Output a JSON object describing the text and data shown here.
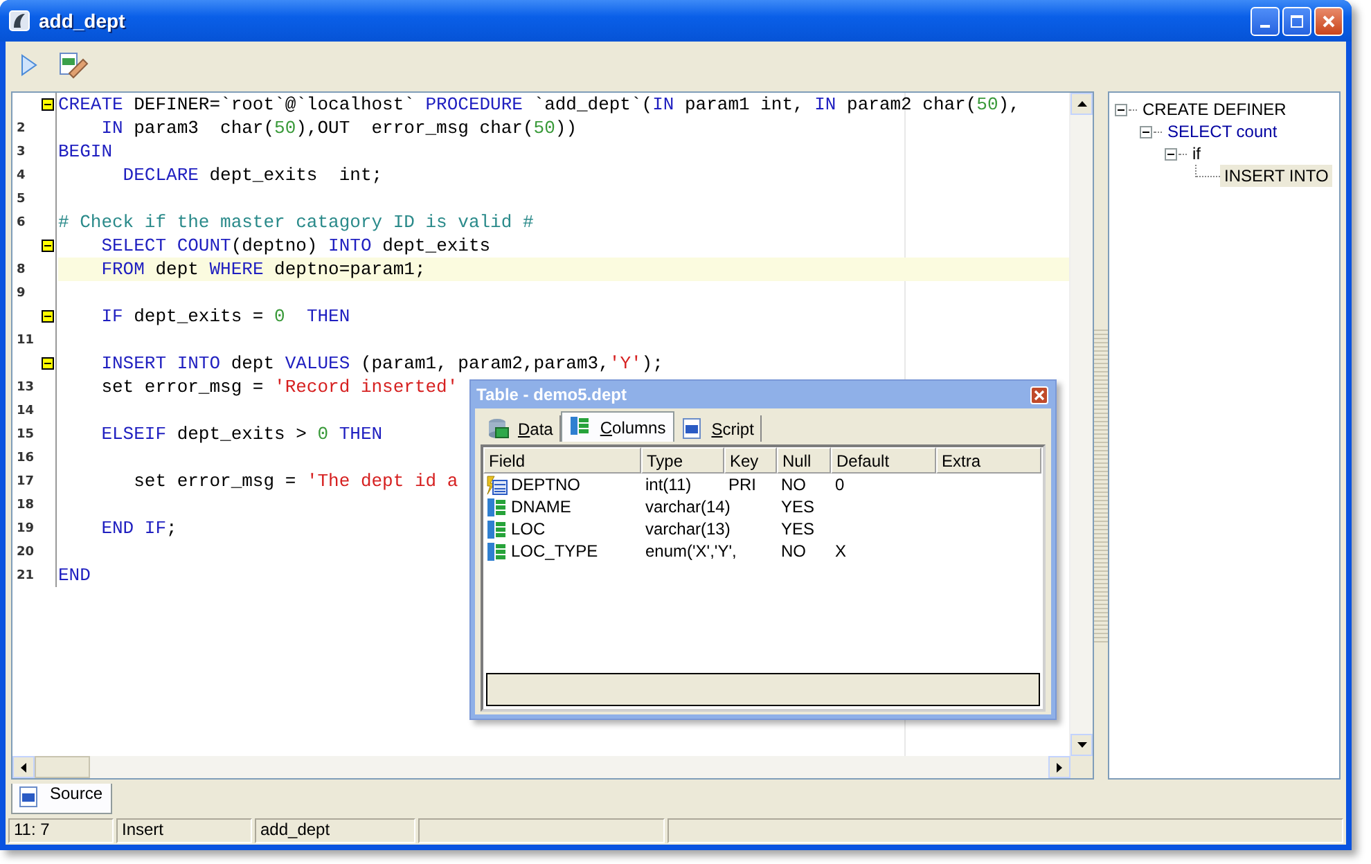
{
  "window": {
    "title": "add_dept"
  },
  "editor": {
    "lines": [
      {
        "fold": true,
        "current": false,
        "tokens": [
          {
            "text": "CREATE",
            "kind": "kw"
          },
          {
            "text": " DEFINER=`root`@`localhost` ",
            "kind": "plain"
          },
          {
            "text": "PROCEDURE",
            "kind": "kw"
          },
          {
            "text": " `add_dept`(",
            "kind": "plain"
          },
          {
            "text": "IN",
            "kind": "kw"
          },
          {
            "text": " param1 int, ",
            "kind": "plain"
          },
          {
            "text": "IN",
            "kind": "kw"
          },
          {
            "text": " param2 char(",
            "kind": "plain"
          },
          {
            "text": "50",
            "kind": "num"
          },
          {
            "text": "),",
            "kind": "plain"
          }
        ]
      },
      {
        "number": "2",
        "fold": false,
        "current": false,
        "tokens": [
          {
            "text": "    IN",
            "kind": "kw"
          },
          {
            "text": " param3  char(",
            "kind": "plain"
          },
          {
            "text": "50",
            "kind": "num"
          },
          {
            "text": "),OUT  error_msg char(",
            "kind": "plain"
          },
          {
            "text": "50",
            "kind": "num"
          },
          {
            "text": "))",
            "kind": "plain"
          }
        ]
      },
      {
        "number": "3",
        "fold": false,
        "current": false,
        "tokens": [
          {
            "text": "BEGIN",
            "kind": "kw"
          }
        ]
      },
      {
        "number": "4",
        "fold": false,
        "current": false,
        "tokens": [
          {
            "text": "      DECLARE",
            "kind": "kw"
          },
          {
            "text": " dept_exits  int;",
            "kind": "plain"
          }
        ]
      },
      {
        "number": "5",
        "fold": false,
        "current": false
      },
      {
        "number": "6",
        "fold": false,
        "current": false,
        "tokens": [
          {
            "text": "# Check if the master catagory ID is valid #",
            "kind": "comment"
          }
        ]
      },
      {
        "fold": true,
        "current": false,
        "tokens": [
          {
            "text": "    SELECT COUNT",
            "kind": "kw"
          },
          {
            "text": "(deptno) ",
            "kind": "plain"
          },
          {
            "text": "INTO",
            "kind": "kw"
          },
          {
            "text": " dept_exits",
            "kind": "plain"
          }
        ]
      },
      {
        "number": "8",
        "fold": false,
        "current": true,
        "tokens": [
          {
            "text": "    FROM",
            "kind": "kw"
          },
          {
            "text": " dept ",
            "kind": "plain"
          },
          {
            "text": "WHERE",
            "kind": "kw"
          },
          {
            "text": " deptno=param1;",
            "kind": "plain"
          }
        ]
      },
      {
        "number": "9",
        "fold": false,
        "current": false
      },
      {
        "fold": true,
        "current": false,
        "tokens": [
          {
            "text": "    IF",
            "kind": "kw"
          },
          {
            "text": " dept_exits = ",
            "kind": "plain"
          },
          {
            "text": "0",
            "kind": "num"
          },
          {
            "text": "  THEN",
            "kind": "kw"
          }
        ]
      },
      {
        "number": "11",
        "fold": false,
        "current": false
      },
      {
        "fold": true,
        "current": false,
        "tokens": [
          {
            "text": "    INSERT INTO",
            "kind": "kw"
          },
          {
            "text": " dept ",
            "kind": "plain"
          },
          {
            "text": "VALUES",
            "kind": "kw"
          },
          {
            "text": " (param1, param2,param3,",
            "kind": "plain"
          },
          {
            "text": "'Y'",
            "kind": "str"
          },
          {
            "text": ");",
            "kind": "plain"
          }
        ]
      },
      {
        "number": "13",
        "fold": false,
        "current": false,
        "tokens": [
          {
            "text": "    set error_msg = ",
            "kind": "plain"
          },
          {
            "text": "'Record inserted'",
            "kind": "str"
          }
        ]
      },
      {
        "number": "14",
        "fold": false,
        "current": false
      },
      {
        "number": "15",
        "fold": false,
        "current": false,
        "tokens": [
          {
            "text": "    ELSEIF",
            "kind": "kw"
          },
          {
            "text": " dept_exits > ",
            "kind": "plain"
          },
          {
            "text": "0",
            "kind": "num"
          },
          {
            "text": " THEN",
            "kind": "kw"
          }
        ]
      },
      {
        "number": "16",
        "fold": false,
        "current": false
      },
      {
        "number": "17",
        "fold": false,
        "current": false,
        "tokens": [
          {
            "text": "       set error_msg = ",
            "kind": "plain"
          },
          {
            "text": "'The dept id a",
            "kind": "str"
          }
        ]
      },
      {
        "number": "18",
        "fold": false,
        "current": false
      },
      {
        "number": "19",
        "fold": false,
        "current": false,
        "tokens": [
          {
            "text": "    END IF",
            "kind": "kw"
          },
          {
            "text": ";",
            "kind": "plain"
          }
        ]
      },
      {
        "number": "20",
        "fold": false,
        "current": false
      },
      {
        "number": "21",
        "fold": false,
        "current": false,
        "tokens": [
          {
            "text": "END",
            "kind": "kw"
          }
        ]
      }
    ]
  },
  "tree": [
    {
      "label": "CREATE DEFINER",
      "color": "#000000",
      "expanded": true,
      "selected": false,
      "children": [
        {
          "label": "SELECT count",
          "color": "#0000a0",
          "expanded": true,
          "selected": false,
          "children": [
            {
              "label": "if",
              "color": "#000000",
              "expanded": true,
              "selected": false,
              "children": [
                {
                  "label": "INSERT INTO",
                  "color": "#000000",
                  "selected": true
                }
              ]
            }
          ]
        }
      ]
    }
  ],
  "dialog": {
    "title": "Table - demo5.dept",
    "tabs": [
      {
        "label": "Data",
        "kind": "data",
        "selected": false
      },
      {
        "label": "Columns",
        "kind": "columns",
        "selected": true
      },
      {
        "label": "Script",
        "kind": "script",
        "selected": false
      }
    ],
    "columns": [
      "Field",
      "Type",
      "Key",
      "Null",
      "Default",
      "Extra"
    ],
    "rows": [
      {
        "kind": "key",
        "cells": [
          "DEPTNO",
          "int(11)",
          "PRI",
          "NO",
          "0"
        ]
      },
      {
        "kind": "column",
        "cells": [
          "DNAME",
          "varchar(14)",
          "",
          "YES",
          ""
        ]
      },
      {
        "kind": "column",
        "cells": [
          "LOC",
          "varchar(13)",
          "",
          "YES",
          ""
        ]
      },
      {
        "kind": "column",
        "cells": [
          "LOC_TYPE",
          "enum('X','Y',",
          "",
          "NO",
          "X"
        ]
      }
    ]
  },
  "bottom_tabs": [
    {
      "label": "Source",
      "selected": true
    }
  ],
  "status_bar": [
    "11: 7",
    "Insert",
    "add_dept"
  ]
}
